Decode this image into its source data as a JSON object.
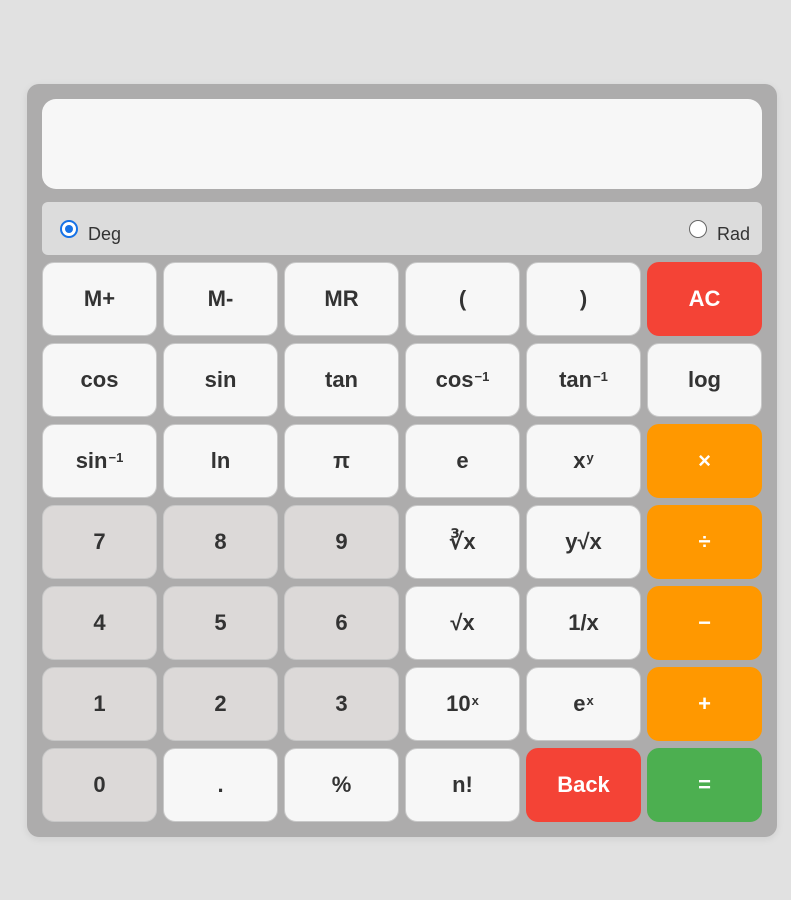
{
  "display": {
    "value": ""
  },
  "mode": {
    "deg_label": "Deg",
    "rad_label": "Rad",
    "selected": "Deg"
  },
  "keys": {
    "m_plus": "M+",
    "m_minus": "M-",
    "mr": "MR",
    "open_paren": "(",
    "close_paren": ")",
    "ac": "AC",
    "cos": "cos",
    "sin": "sin",
    "tan": "tan",
    "acos_base": "cos",
    "acos_sup": "−1",
    "atan_base": "tan",
    "atan_sup": "−1",
    "log": "log",
    "asin_base": "sin",
    "asin_sup": "−1",
    "ln": "ln",
    "pi": "π",
    "e": "e",
    "pow_base": "x",
    "pow_sup": "y",
    "multiply": "×",
    "seven": "7",
    "eight": "8",
    "nine": "9",
    "cbrt": "∛x",
    "yroot": "y√x",
    "divide": "÷",
    "four": "4",
    "five": "5",
    "six": "6",
    "sqrt": "√x",
    "reciprocal": "1/x",
    "minus": "−",
    "one": "1",
    "two": "2",
    "three": "3",
    "ten_pow_base": "10",
    "ten_pow_sup": "x",
    "exp_base": "e",
    "exp_sup": "x",
    "plus": "+",
    "zero": "0",
    "dot": ".",
    "percent": "%",
    "factorial": "n!",
    "back": "Back",
    "equals": "="
  },
  "colors": {
    "clear_red": "#f44336",
    "operator_orange": "#ff9800",
    "equals_green": "#4caf50",
    "radio_blue": "#1672e6"
  }
}
